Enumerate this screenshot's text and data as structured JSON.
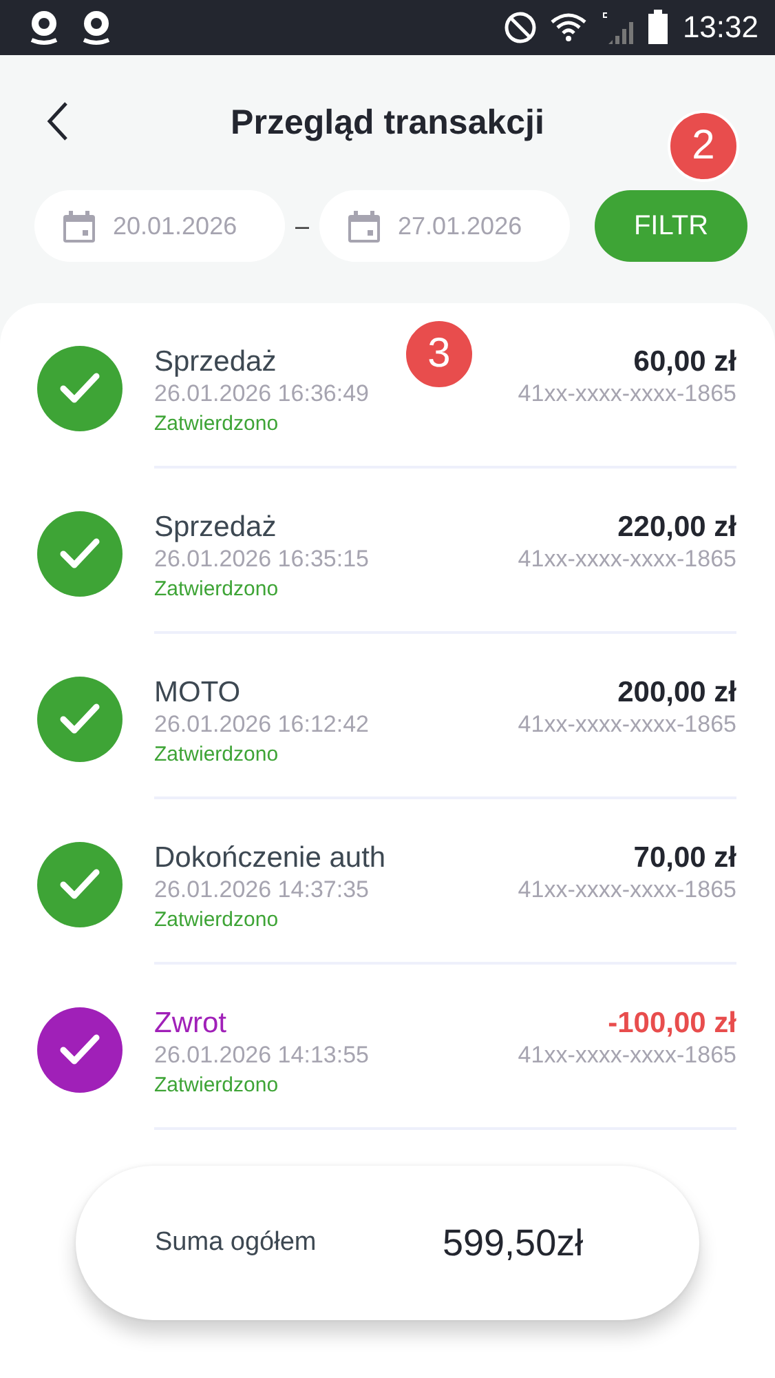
{
  "status_bar": {
    "time": "13:32"
  },
  "header": {
    "title": "Przegląd transakcji"
  },
  "filter": {
    "date_from": "20.01.2026",
    "separator": "–",
    "date_to": "27.01.2026",
    "button": "FILTR",
    "badge": "2"
  },
  "transactions": [
    {
      "kind": "sale",
      "badge": "3",
      "type": "Sprzedaż",
      "datetime": "26.01.2026 16:36:49",
      "status": "Zatwierdzono",
      "amount": "60,00 zł",
      "card": "41xx-xxxx-xxxx-1865"
    },
    {
      "kind": "sale",
      "type": "Sprzedaż",
      "datetime": "26.01.2026 16:35:15",
      "status": "Zatwierdzono",
      "amount": "220,00 zł",
      "card": "41xx-xxxx-xxxx-1865"
    },
    {
      "kind": "sale",
      "type": "MOTO",
      "datetime": "26.01.2026 16:12:42",
      "status": "Zatwierdzono",
      "amount": "200,00 zł",
      "card": "41xx-xxxx-xxxx-1865"
    },
    {
      "kind": "sale",
      "type": "Dokończenie auth",
      "datetime": "26.01.2026 14:37:35",
      "status": "Zatwierdzono",
      "amount": "70,00 zł",
      "card": "41xx-xxxx-xxxx-1865"
    },
    {
      "kind": "refund",
      "type": "Zwrot",
      "datetime": "26.01.2026 14:13:55",
      "status": "Zatwierdzono",
      "amount": "-100,00 zł",
      "card": "41xx-xxxx-xxxx-1865"
    }
  ],
  "total": {
    "label": "Suma ogółem",
    "value": "599,50zł"
  }
}
